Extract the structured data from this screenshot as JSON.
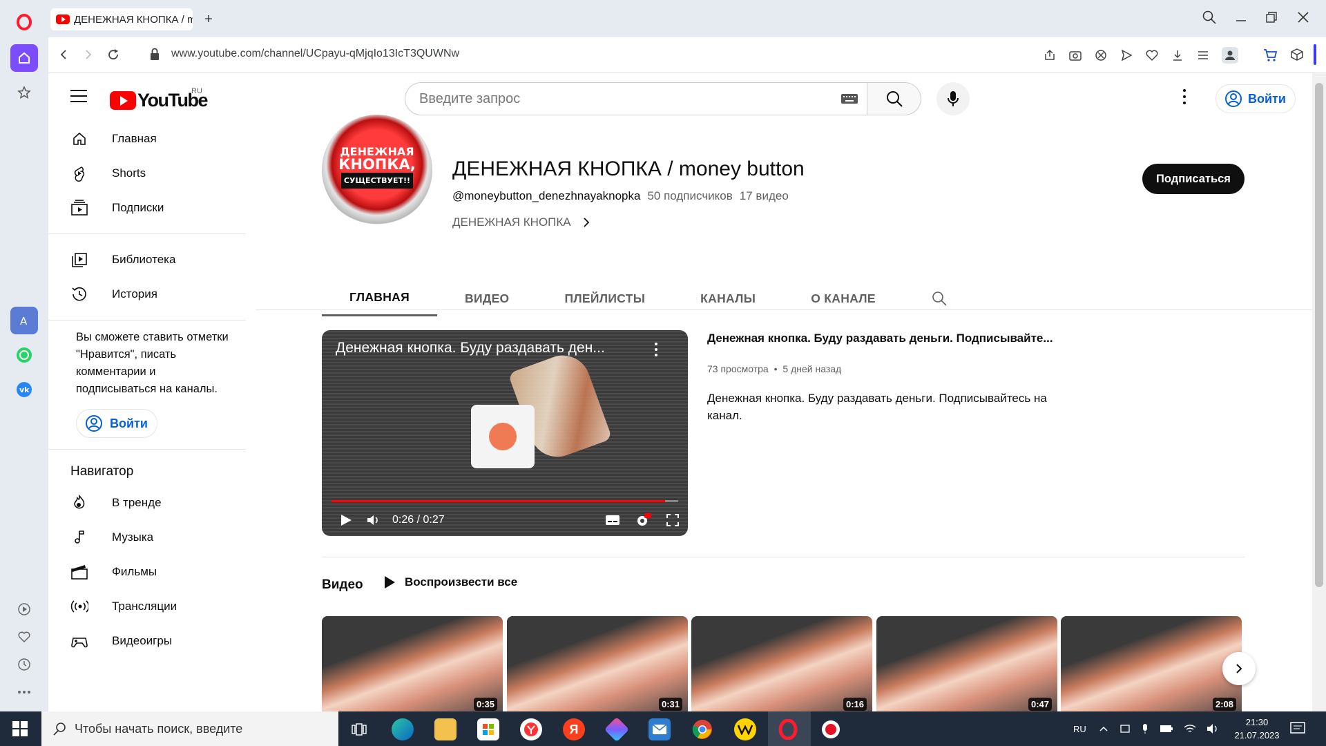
{
  "browser": {
    "tab_title": "ДЕНЕЖНАЯ КНОПКА / m",
    "url": "www.youtube.com/channel/UCpayu-qMjqIo13IcT3QUWNw"
  },
  "masthead": {
    "country": "RU",
    "logo_text": "YouTube",
    "search_placeholder": "Введите запрос",
    "signin_label": "Войти"
  },
  "guide": {
    "main_items": [
      {
        "label": "Главная",
        "icon": "home-icon"
      },
      {
        "label": "Shorts",
        "icon": "shorts-icon"
      },
      {
        "label": "Подписки",
        "icon": "subscriptions-icon"
      }
    ],
    "library_items": [
      {
        "label": "Библиотека",
        "icon": "library-icon"
      },
      {
        "label": "История",
        "icon": "history-icon"
      }
    ],
    "signin_note": "Вы сможете ставить отметки \"Нравится\", писать комментарии и подписываться на каналы.",
    "signin_label": "Войти",
    "navigator_title": "Навигатор",
    "navigator_items": [
      {
        "label": "В тренде",
        "icon": "trending-icon"
      },
      {
        "label": "Музыка",
        "icon": "music-icon"
      },
      {
        "label": "Фильмы",
        "icon": "movies-icon"
      },
      {
        "label": "Трансляции",
        "icon": "live-icon"
      },
      {
        "label": "Видеоигры",
        "icon": "gaming-icon"
      }
    ]
  },
  "channel": {
    "avatar_text_line1": "ДЕНЕЖНАЯ",
    "avatar_text_line2": "КНОПКА,",
    "avatar_text_line3": "СУЩЕСТВУЕТ!!",
    "title": "ДЕНЕЖНАЯ КНОПКА / money button",
    "handle": "@moneybutton_denezhnayaknopka",
    "subscribers": "50 подписчиков",
    "videos_count": "17 видео",
    "description_link": "ДЕНЕЖНАЯ КНОПКА",
    "subscribe_label": "Подписаться",
    "tabs": [
      "ГЛАВНАЯ",
      "ВИДЕО",
      "ПЛЕЙЛИСТЫ",
      "КАНАЛЫ",
      "О КАНАЛЕ"
    ],
    "active_tab": "ГЛАВНАЯ"
  },
  "featured": {
    "player_title": "Денежная кнопка. Буду раздавать ден...",
    "time": "0:26 / 0:27",
    "progress": 0.963,
    "title": "Денежная кнопка. Буду раздавать деньги. Подписывайте...",
    "views": "73 просмотра",
    "age": "5 дней назад",
    "meta_sep": "•",
    "description": "Денежная кнопка. Буду раздавать деньги. Подписывайтесь на канал."
  },
  "shelf": {
    "title": "Видео",
    "play_all_label": "Воспроизвести все",
    "durations": [
      "0:35",
      "0:31",
      "0:16",
      "0:47",
      "2:08"
    ]
  },
  "taskbar": {
    "search_placeholder": "Чтобы начать поиск, введите",
    "lang": "RU",
    "time": "21:30",
    "date": "21.07.2023",
    "yandex_letter": "Я"
  },
  "colors": {
    "brand_red": "#ff0000",
    "link_blue": "#065fd4",
    "taskbar_bg": "#1f2b3a",
    "browser_chrome": "#e6ebf1"
  }
}
